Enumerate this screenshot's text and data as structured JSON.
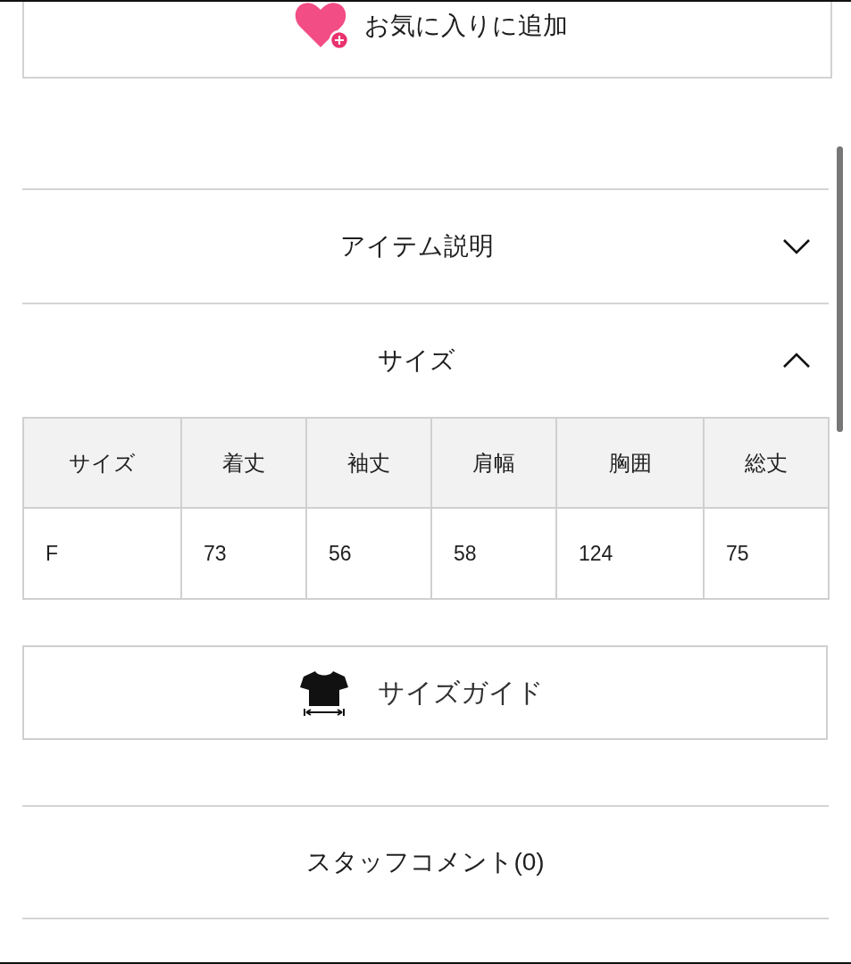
{
  "favorite_button": {
    "label": "お気に入りに追加"
  },
  "accordions": [
    {
      "title": "アイテム説明",
      "expanded": false
    },
    {
      "title": "サイズ",
      "expanded": true,
      "table": {
        "columns": [
          "サイズ",
          "着丈",
          "袖丈",
          "肩幅",
          "胸囲",
          "総丈"
        ],
        "rows": [
          [
            "F",
            "73",
            "56",
            "58",
            "124",
            "75"
          ]
        ]
      },
      "guide_button": {
        "label": "サイズガイド"
      }
    }
  ],
  "staff_comment": {
    "label": "スタッフコメント(0)"
  }
}
